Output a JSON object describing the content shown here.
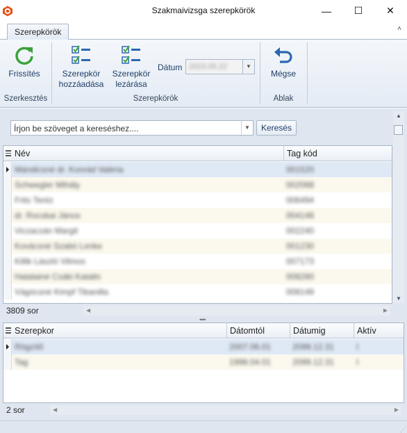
{
  "window": {
    "title": "Szakmaivizsga szerepkörök",
    "icon": "app-logo-icon",
    "controls": {
      "minimize": "—",
      "maximize": "☐",
      "close": "✕"
    }
  },
  "ribbon": {
    "tab": "Szerepkörök",
    "collapse_glyph": "˄",
    "groups": {
      "szerkesztes": "Szerkesztés",
      "szerepkorok": "Szerepkörök",
      "ablak": "Ablak"
    },
    "buttons": {
      "refresh": "Frissítés",
      "add_line1": "Szerepkör",
      "add_line2": "hozzáadása",
      "close_line1": "Szerepkör",
      "close_line2": "lezárása",
      "cancel": "Mégse"
    },
    "datum_label": "Dátum",
    "datum_value": "2023.05.22",
    "colors": {
      "accent_green": "#3aa33a",
      "accent_blue": "#2a67b1"
    }
  },
  "search": {
    "placeholder": "Írjon be szöveget a kereséshez....",
    "button": "Keresés"
  },
  "upper_grid": {
    "columns": [
      "Név",
      "Tag kód"
    ],
    "rows": [
      [
        "Mándicsné dr. Konrád Valéria",
        "001520"
      ],
      [
        "Schwegler Mihály",
        "002068"
      ],
      [
        "Frits Teréz",
        "006494"
      ],
      [
        "dr. Rocskai János",
        "004148"
      ],
      [
        "Viczaczán Margit",
        "002240"
      ],
      [
        "Kovácsné Szabó Lenke",
        "001230"
      ],
      [
        "Killik László Vilmos",
        "007173"
      ],
      [
        "Hatalainé Csáki Katalin",
        "008280"
      ],
      [
        "Vágócsné Kimpf Tibanilla",
        "008149"
      ]
    ],
    "count": "3809 sor"
  },
  "lower_grid": {
    "columns": [
      "Szerepkor",
      "Dátomtól",
      "Dátumig",
      "Aktív"
    ],
    "rows": [
      [
        "Rögzítő",
        "2007.06.01",
        "2099.12.31",
        "I"
      ],
      [
        "Tag",
        "1998.04.01",
        "2099.12.31",
        "I"
      ]
    ],
    "count": "2 sor"
  }
}
